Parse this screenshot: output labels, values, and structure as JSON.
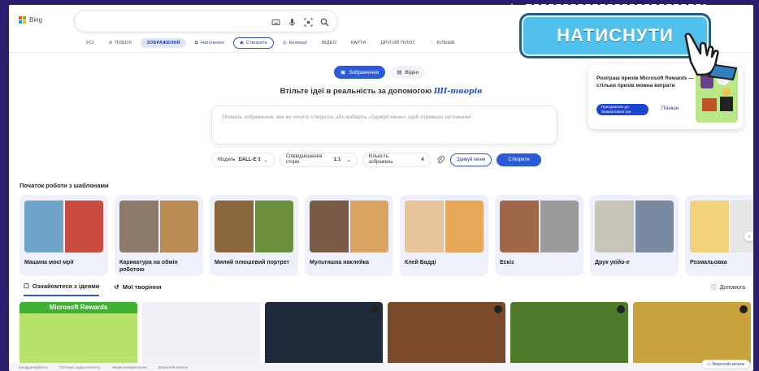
{
  "header": {
    "logo_text": "Bing",
    "nav_tabs": [
      {
        "label": "УСІ",
        "style": "plain"
      },
      {
        "label": "ПОШУК",
        "style": "plain"
      },
      {
        "label": "ЗОБРАЖЕННЯ",
        "style": "active"
      },
      {
        "label": "Натхнення",
        "style": "blue"
      },
      {
        "label": "Створити",
        "style": "outline"
      },
      {
        "label": "Колекції",
        "style": "blue"
      },
      {
        "label": "ВІДЕО",
        "style": "plain"
      },
      {
        "label": "КАРТИ",
        "style": "plain"
      },
      {
        "label": "ДРУГИЙ ПІЛОТ",
        "style": "plain"
      },
      {
        "label": "БІЛЬШЕ",
        "style": "plain"
      }
    ]
  },
  "promo": {
    "button_label": "НАТИСНУТИ",
    "accent": "#4fc1ec"
  },
  "rewards": {
    "text": "Розіграш призів Microsoft Rewards — стільки призів можна виграти",
    "join_label": "Приєднатися до безкоштовної гри",
    "later_label": "Пізніше"
  },
  "creator": {
    "mode_images": "Зображення",
    "mode_video": "Відео",
    "headline": "Втільте ідеї в реальність за допомогою",
    "headline_brand": "ШІ-творів",
    "prompt_placeholder": "Опишіть зображення, яке ви хочете створити, або виберіть «Здивуй мене», щоб отримати натхнення!",
    "model_label": "Модель",
    "model_value": "DALL-E 3",
    "aspect_label": "Співвідношення сторін",
    "aspect_value": "1:1",
    "count_label": "Кількість зображень",
    "count_value": "4",
    "surprise_label": "Здивуй мене",
    "create_label": "Створити"
  },
  "templates": {
    "title": "Початок роботи з шаблонами",
    "items": [
      {
        "label": "Машина моєї мрії",
        "c1": "#6fa3c8",
        "c2": "#c94a3f"
      },
      {
        "label": "Карикатура на обмін роботою",
        "c1": "#8d7a68",
        "c2": "#b98a52"
      },
      {
        "label": "Милий плюшевий портрет",
        "c1": "#8a6a3c",
        "c2": "#6b8f3a"
      },
      {
        "label": "Мультяшна наклейка",
        "c1": "#7a5a44",
        "c2": "#d9a45f"
      },
      {
        "label": "Клей Бадді",
        "c1": "#e7c59a",
        "c2": "#e8a85a"
      },
      {
        "label": "Ескіз",
        "c1": "#a0674a",
        "c2": "#9a9a9a"
      },
      {
        "label": "Друк укійо-е",
        "c1": "#c9c6b8",
        "c2": "#7a8aa0"
      },
      {
        "label": "Розмальовка",
        "c1": "#f2d27a",
        "c2": "#e6e6e6"
      }
    ]
  },
  "lower_tabs": {
    "explore": "Ознайомтеся з ідеями",
    "mine": "Мої творіння",
    "help": "Допомога"
  },
  "gallery": [
    {
      "caption": "Microsoft Rewards",
      "bg": "#b6e36a"
    },
    {
      "caption": "",
      "bg": "#eef0f5"
    },
    {
      "caption": "",
      "bg": "#1f2a3a"
    },
    {
      "caption": "",
      "bg": "#7a4a2a"
    },
    {
      "caption": "",
      "bg": "#4f7a2a"
    },
    {
      "caption": "",
      "bg": "#c8a23a"
    }
  ],
  "footer": {
    "links": [
      "Конфіденційність",
      "Політика щодо контенту",
      "Умови використання",
      "Зворотній зв'язок"
    ],
    "feedback": "Зворотній зв'язок"
  }
}
